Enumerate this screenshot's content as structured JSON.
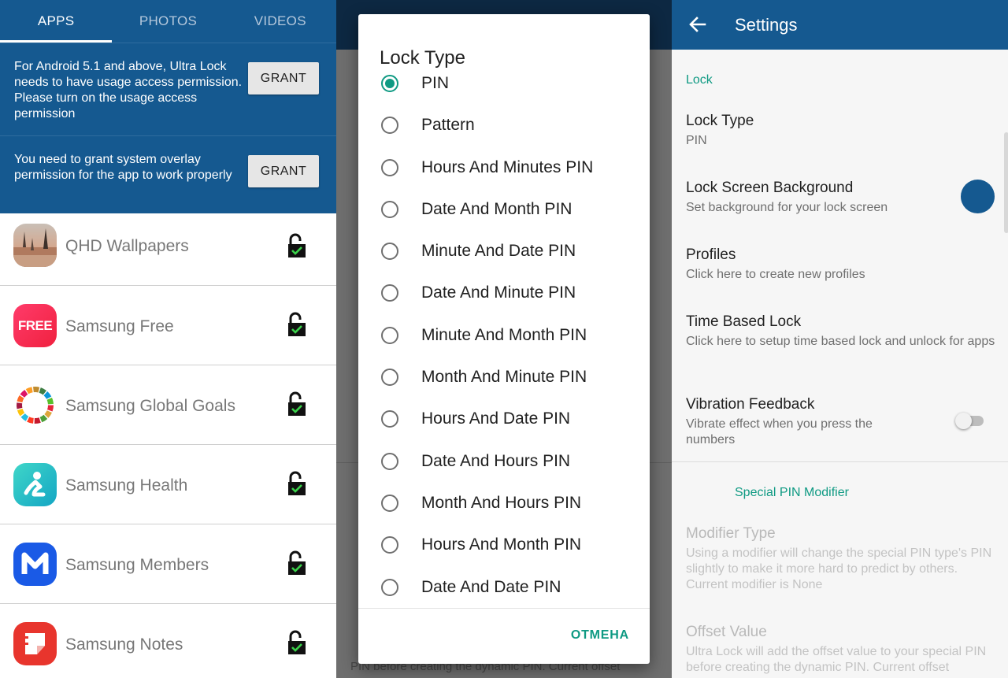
{
  "left": {
    "tabs": [
      {
        "label": "APPS",
        "active": true
      },
      {
        "label": "PHOTOS",
        "active": false
      },
      {
        "label": "VIDEOS",
        "active": false
      }
    ],
    "permissions": [
      {
        "message": "For Android 5.1 and above, Ultra Lock needs to have usage access permission. Please turn on the usage access permission",
        "button": "GRANT"
      },
      {
        "message": "You need to grant system overlay permission for the app to work properly",
        "button": "GRANT"
      }
    ],
    "apps": [
      {
        "name": "QHD Wallpapers",
        "icon": "wallpaper-icon"
      },
      {
        "name": "Samsung Free",
        "icon": "samsung-free-icon",
        "icon_text": "FREE"
      },
      {
        "name": "Samsung Global Goals",
        "icon": "global-goals-icon"
      },
      {
        "name": "Samsung Health",
        "icon": "health-icon"
      },
      {
        "name": "Samsung Members",
        "icon": "members-icon"
      },
      {
        "name": "Samsung Notes",
        "icon": "notes-icon"
      }
    ]
  },
  "dialog": {
    "title": "Lock Type",
    "options": [
      {
        "label": "PIN",
        "selected": true
      },
      {
        "label": "Pattern",
        "selected": false
      },
      {
        "label": "Hours And Minutes PIN",
        "selected": false
      },
      {
        "label": "Date And Month PIN",
        "selected": false
      },
      {
        "label": "Minute And Date PIN",
        "selected": false
      },
      {
        "label": "Date And Minute PIN",
        "selected": false
      },
      {
        "label": "Minute And Month PIN",
        "selected": false
      },
      {
        "label": "Month And Minute PIN",
        "selected": false
      },
      {
        "label": "Hours And Date PIN",
        "selected": false
      },
      {
        "label": "Date And Hours PIN",
        "selected": false
      },
      {
        "label": "Month And Hours PIN",
        "selected": false
      },
      {
        "label": "Hours And Month PIN",
        "selected": false
      },
      {
        "label": "Date And Date PIN",
        "selected": false
      }
    ],
    "cancel": "ОТМЕНА",
    "background_fragment": "PIN before creating the dynamic PIN. Current offset"
  },
  "settings": {
    "title": "Settings",
    "section_lock": "Lock",
    "lock_type": {
      "title": "Lock Type",
      "summary": "PIN"
    },
    "lock_bg": {
      "title": "Lock Screen Background",
      "summary": "Set background for your lock screen",
      "color": "#155990"
    },
    "profiles": {
      "title": "Profiles",
      "summary": "Click here to create new profiles"
    },
    "time_lock": {
      "title": "Time Based Lock",
      "summary": "Click here to setup time based lock and unlock for apps"
    },
    "vibration": {
      "title": "Vibration Feedback",
      "summary": "Vibrate effect when you press the numbers",
      "enabled": false
    },
    "section_special": "Special PIN Modifier",
    "modifier": {
      "title": "Modifier Type",
      "summary": "Using a modifier will change the special PIN type's PIN slightly to make it more hard to predict by others. Current modifier is None"
    },
    "offset": {
      "title": "Offset Value",
      "summary": "Ultra Lock will add the offset value to your special PIN before creating the dynamic PIN. Current offset"
    }
  },
  "colors": {
    "primary": "#155990",
    "accent": "#0f9a83",
    "toolbar_dark": "#0d2842"
  }
}
